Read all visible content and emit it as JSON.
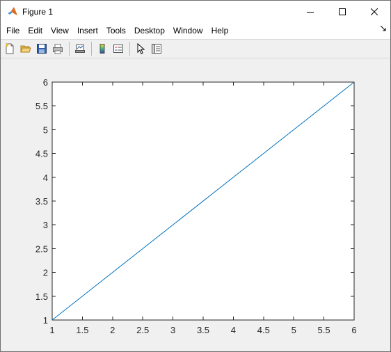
{
  "window": {
    "title": "Figure 1"
  },
  "menu": {
    "items": [
      "File",
      "Edit",
      "View",
      "Insert",
      "Tools",
      "Desktop",
      "Window",
      "Help"
    ]
  },
  "toolbar": {
    "icons": [
      "new-figure-icon",
      "open-file-icon",
      "save-icon",
      "print-icon",
      "link-plot-icon",
      "insert-colorbar-icon",
      "insert-legend-icon",
      "edit-plot-icon",
      "property-inspector-icon"
    ]
  },
  "chart_data": {
    "type": "line",
    "x": [
      1,
      6
    ],
    "series": [
      {
        "values": [
          1,
          6
        ],
        "color": "#0072bd"
      }
    ],
    "xlim": [
      1,
      6
    ],
    "ylim": [
      1,
      6
    ],
    "xticks": [
      "1",
      "1.5",
      "2",
      "2.5",
      "3",
      "3.5",
      "4",
      "4.5",
      "5",
      "5.5",
      "6"
    ],
    "yticks": [
      "1",
      "1.5",
      "2",
      "2.5",
      "3",
      "3.5",
      "4",
      "4.5",
      "5",
      "5.5",
      "6"
    ],
    "title": "",
    "xlabel": "",
    "ylabel": "",
    "grid": false
  }
}
